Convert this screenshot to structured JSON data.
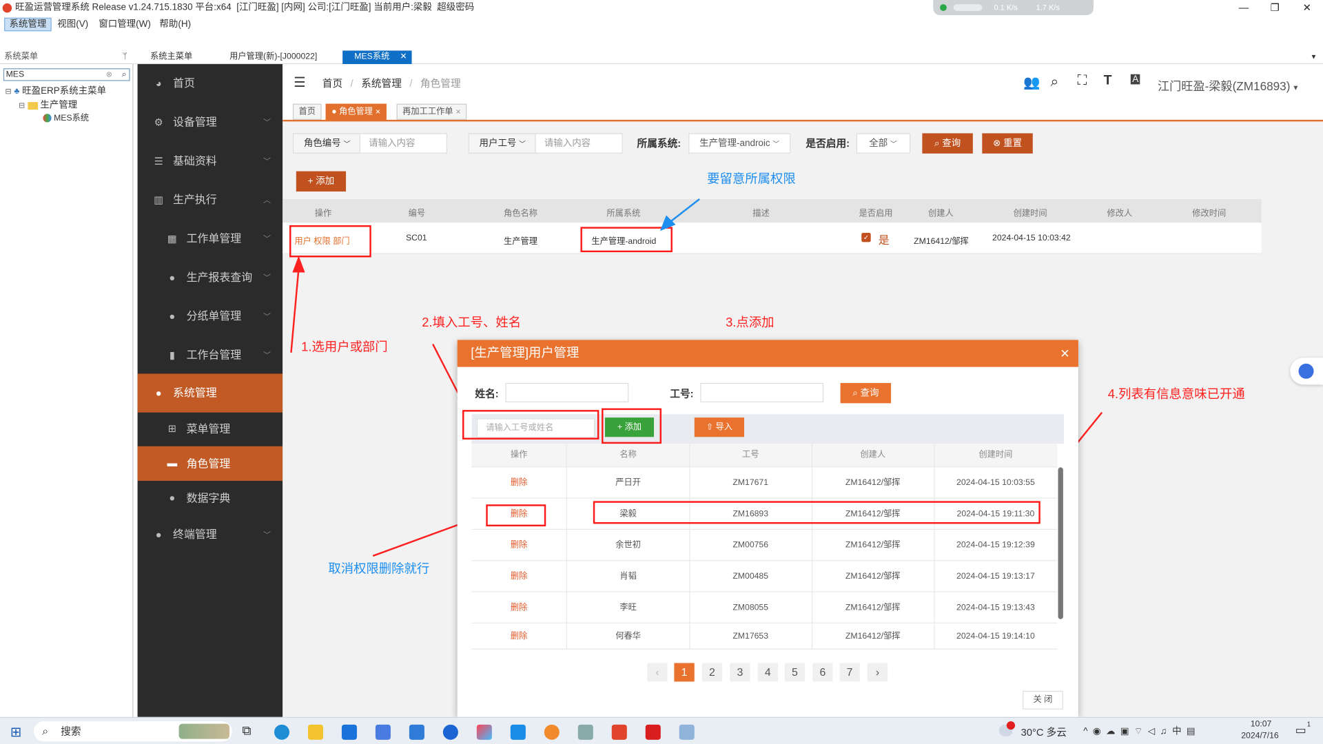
{
  "window": {
    "title": "旺盈运营管理系统 Release v1.24.715.1830 平台:x64  [江门旺盈] [内网] 公司:[江门旺盈] 当前用户:梁毅  超级密码",
    "net_up": "0.1 K/s",
    "net_down": "1.7 K/s",
    "minimize": "—",
    "maximize": "❐",
    "close": "✕"
  },
  "menubar": [
    "系统管理",
    "视图(V)",
    "窗口管理(W)",
    "帮助(H)"
  ],
  "tabs": {
    "left_title": "系统菜单",
    "pin": "ᛘ",
    "items": [
      "系统主菜单",
      "用户管理(新)-[J000022]",
      "MES系统"
    ],
    "close_icon": "✕"
  },
  "left_panel": {
    "search_value": "MES",
    "tree": [
      "旺盈ERP系统主菜单",
      "生产管理",
      "MES系统"
    ]
  },
  "sidebar": {
    "items": [
      {
        "label": "首页",
        "icon": "dashboard-icon"
      },
      {
        "label": "设备管理",
        "icon": "gears-icon"
      },
      {
        "label": "基础资料",
        "icon": "list-icon"
      },
      {
        "label": "生产执行",
        "icon": "factory-icon"
      },
      {
        "label": "工作单管理",
        "icon": "building-icon"
      },
      {
        "label": "生产报表查询",
        "icon": "user-icon"
      },
      {
        "label": "分纸单管理",
        "icon": "user-icon"
      },
      {
        "label": "工作台管理",
        "icon": "chart-icon"
      },
      {
        "label": "系统管理",
        "icon": "user-icon"
      },
      {
        "label": "菜单管理",
        "icon": "sitemap-icon"
      },
      {
        "label": "角色管理",
        "icon": "lock-icon"
      },
      {
        "label": "数据字典",
        "icon": "user-icon"
      },
      {
        "label": "终端管理",
        "icon": "user-icon"
      }
    ]
  },
  "header": {
    "breadcrumb": [
      "首页",
      "系统管理",
      "角色管理"
    ],
    "separator": "/",
    "user": "江门旺盈-梁毅(ZM16893)",
    "user_caret": "▾"
  },
  "page_tags": [
    "首页",
    "角色管理",
    "再加工工作单"
  ],
  "filters": {
    "role_code_label": "角色编号",
    "role_code_placeholder": "请输入内容",
    "user_code_label": "用户工号",
    "user_code_placeholder": "请输入内容",
    "system_label": "所属系统:",
    "system_value": "生产管理-androic",
    "enabled_label": "是否启用:",
    "enabled_value": "全部",
    "query_button": "查询",
    "reset_button": "重置",
    "add_button": "添加"
  },
  "role_table": {
    "headers": [
      "操作",
      "编号",
      "角色名称",
      "所属系统",
      "描述",
      "是否启用",
      "创建人",
      "创建时间",
      "修改人",
      "修改时间"
    ],
    "row": {
      "actions": "用户  权限  部门",
      "code": "SC01",
      "name": "生产管理",
      "system": "生产管理-android",
      "description": "",
      "enabled": "是",
      "creator": "ZM16412/邹挥",
      "created": "2024-04-15 10:03:42",
      "modifier": "",
      "modified": ""
    }
  },
  "annotations": {
    "top": "要留意所属权限",
    "step1": "1.选用户或部门",
    "step2": "2.填入工号、姓名",
    "step3": "3.点添加",
    "step4": "4.列表有信息意味已开通",
    "delete_note": "取消权限删除就行"
  },
  "dialog": {
    "title": "[生产管理]用户管理",
    "close_icon": "✕",
    "name_label": "姓名:",
    "name_value": "",
    "code_label": "工号:",
    "code_value": "",
    "query_button": "查询",
    "add_input_placeholder": "请输入工号或姓名",
    "add_button": "添加",
    "import_button": "导入",
    "headers": [
      "操作",
      "名称",
      "工号",
      "创建人",
      "创建时间"
    ],
    "rows": [
      {
        "action": "删除",
        "name": "严日开",
        "code": "ZM17671",
        "creator": "ZM16412/邹挥",
        "created": "2024-04-15 10:03:55"
      },
      {
        "action": "删除",
        "name": "梁毅",
        "code": "ZM16893",
        "creator": "ZM16412/邹挥",
        "created": "2024-04-15 19:11:30"
      },
      {
        "action": "删除",
        "name": "余世初",
        "code": "ZM00756",
        "creator": "ZM16412/邹挥",
        "created": "2024-04-15 19:12:39"
      },
      {
        "action": "删除",
        "name": "肖韬",
        "code": "ZM00485",
        "creator": "ZM16412/邹挥",
        "created": "2024-04-15 19:13:17"
      },
      {
        "action": "删除",
        "name": "李旺",
        "code": "ZM08055",
        "creator": "ZM16412/邹挥",
        "created": "2024-04-15 19:13:43"
      },
      {
        "action": "删除",
        "name": "何春华",
        "code": "ZM17653",
        "creator": "ZM16412/邹挥",
        "created": "2024-04-15 19:14:10"
      }
    ],
    "pages": [
      "1",
      "2",
      "3",
      "4",
      "5",
      "6",
      "7"
    ],
    "prev": "‹",
    "next": "›",
    "close_button": "关 闭"
  },
  "taskbar": {
    "search_label": "搜索",
    "weather": "30°C 多云",
    "time": "10:07",
    "date": "2024/7/16",
    "notification_count": "1"
  }
}
